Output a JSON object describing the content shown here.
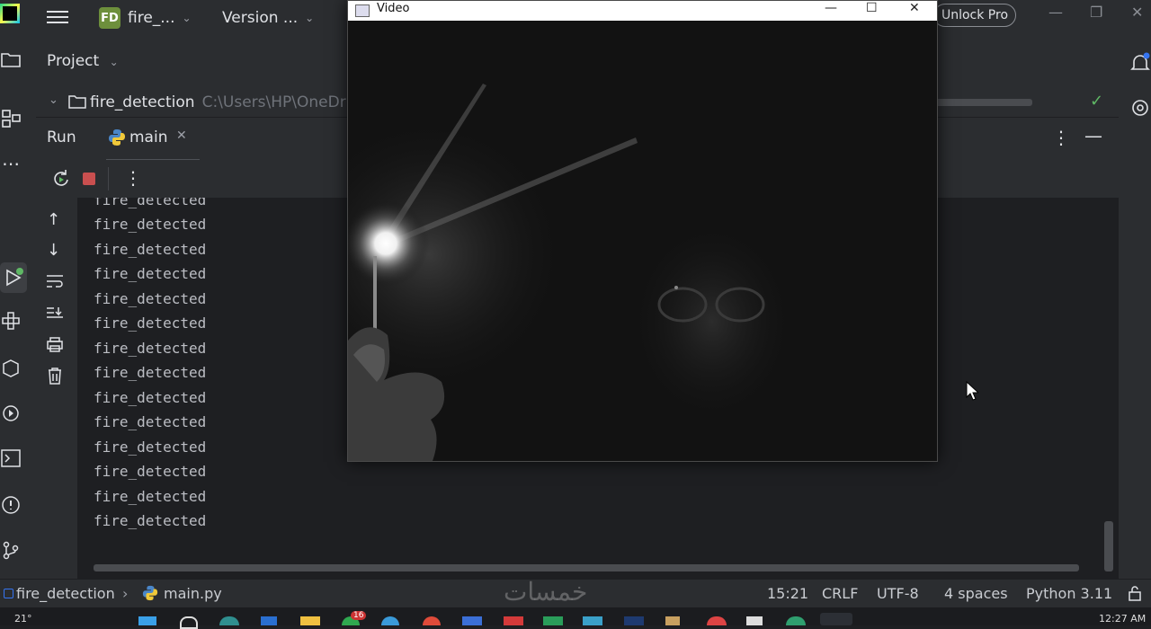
{
  "titlebar": {
    "project_badge": "FD",
    "project_name": "fire_...",
    "vcs_label": "Version ...",
    "unlock_label": "Unlock Pro"
  },
  "project_panel": {
    "title": "Project",
    "root_name": "fire_detection",
    "root_path": "C:\\Users\\HP\\OneDriv"
  },
  "run_panel": {
    "title": "Run",
    "tab_label": "main",
    "console_lines": [
      "fire_detected",
      "fire_detected",
      "fire_detected",
      "fire_detected",
      "fire_detected",
      "fire_detected",
      "fire_detected",
      "fire_detected",
      "fire_detected",
      "fire_detected",
      "fire_detected",
      "fire_detected",
      "fire_detected",
      "fire_detected"
    ],
    "partial_top_line": "fire_detected"
  },
  "video_window": {
    "title": "Video"
  },
  "statusbar": {
    "breadcrumb_project": "fire_detection",
    "breadcrumb_file": "main.py",
    "position": "15:21",
    "line_separator": "CRLF",
    "encoding": "UTF-8",
    "indent": "4 spaces",
    "interpreter": "Python 3.11"
  },
  "taskbar": {
    "weather": "21°",
    "time": "12:27 AM",
    "badge_count": "16"
  },
  "watermark": "خمسات",
  "colors": {
    "accent_green": "#5fb865",
    "stop_red": "#c94f4f",
    "bg_dark": "#1e1f22",
    "panel": "#2b2d30"
  }
}
